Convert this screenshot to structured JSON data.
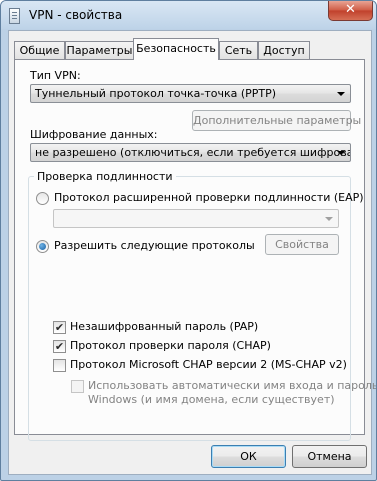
{
  "window": {
    "title": "VPN - свойства",
    "close_glyph": "✕"
  },
  "tabs": [
    {
      "label": "Общие"
    },
    {
      "label": "Параметры"
    },
    {
      "label": "Безопасность"
    },
    {
      "label": "Сеть"
    },
    {
      "label": "Доступ"
    }
  ],
  "security": {
    "vpn_type_label": "Тип VPN:",
    "vpn_type_value": "Туннельный протокол точка-точка (PPTP)",
    "advanced_button": "Дополнительные параметры",
    "encryption_label": "Шифрование данных:",
    "encryption_value": "не разрешено (отключиться, если требуется шифрование)",
    "auth_group_title": "Проверка подлинности",
    "eap_radio_label": "Протокол расширенной проверки подлинности (EAP)",
    "eap_combo_value": "",
    "allow_radio_label": "Разрешить следующие протоколы",
    "properties_button": "Свойства",
    "pap_label": "Незашифрованный пароль (PAP)",
    "chap_label": "Протокол проверки пароля (CHAP)",
    "mschap_label": "Протокол Microsoft CHAP версии 2 (MS-CHAP v2)",
    "autologon_line1": "Использовать автоматически имя входа и пароль",
    "autologon_line2": "Windows (и имя домена, если существует)",
    "check_glyph": "✔"
  },
  "footer": {
    "ok_label": "ОК",
    "cancel_label": "Отмена"
  }
}
